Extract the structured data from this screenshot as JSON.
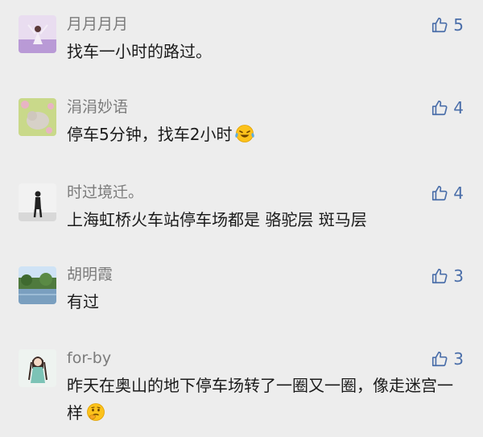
{
  "colors": {
    "background": "#ededed",
    "name": "#7b7b7b",
    "text": "#1a1a1a",
    "like": "#4a6ea9"
  },
  "comments": [
    {
      "name": "月月月月",
      "text": "找车一小时的路过。",
      "likes": "5",
      "avatar_icon": "woman-in-lavender-field-avatar"
    },
    {
      "name": "涓涓妙语",
      "text": "停车5分钟，找车2小时",
      "likes": "4",
      "avatar_icon": "cat-on-grass-avatar",
      "emoji": "laughing-tears-emoji"
    },
    {
      "name": "时过境迁。",
      "text": "上海虹桥火车站停车场都是 骆驼层 斑马层",
      "likes": "4",
      "avatar_icon": "person-standing-avatar"
    },
    {
      "name": "胡明霞",
      "text": "有过",
      "likes": "3",
      "avatar_icon": "lake-landscape-avatar"
    },
    {
      "name": "for-by",
      "text": "昨天在奥山的地下停车场转了一圈又一圈，像走迷宫一样",
      "likes": "3",
      "avatar_icon": "cartoon-girl-avatar",
      "emoji": "thinking-face-emoji"
    }
  ]
}
